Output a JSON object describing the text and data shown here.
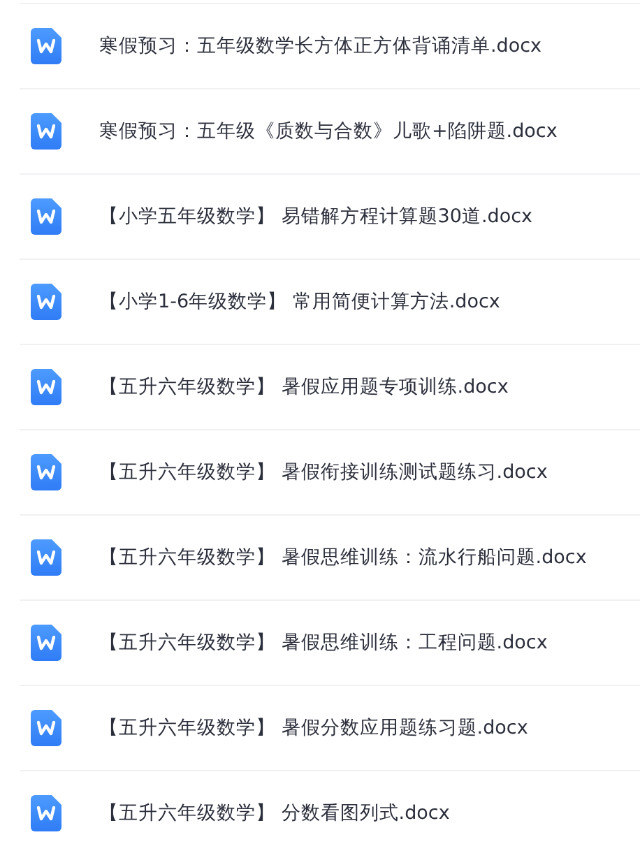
{
  "files": [
    {
      "name": "寒假预习：五年级数学长方体正方体背诵清单.docx"
    },
    {
      "name": "寒假预习：五年级《质数与合数》儿歌+陷阱题.docx"
    },
    {
      "name": "【小学五年级数学】 易错解方程计算题30道.docx"
    },
    {
      "name": "【小学1-6年级数学】 常用简便计算方法.docx"
    },
    {
      "name": "【五升六年级数学】 暑假应用题专项训练.docx"
    },
    {
      "name": "【五升六年级数学】 暑假衔接训练测试题练习.docx"
    },
    {
      "name": "【五升六年级数学】 暑假思维训练：流水行船问题.docx"
    },
    {
      "name": "【五升六年级数学】 暑假思维训练：工程问题.docx"
    },
    {
      "name": "【五升六年级数学】 暑假分数应用题练习题.docx"
    },
    {
      "name": "【五升六年级数学】 分数看图列式.docx"
    }
  ]
}
